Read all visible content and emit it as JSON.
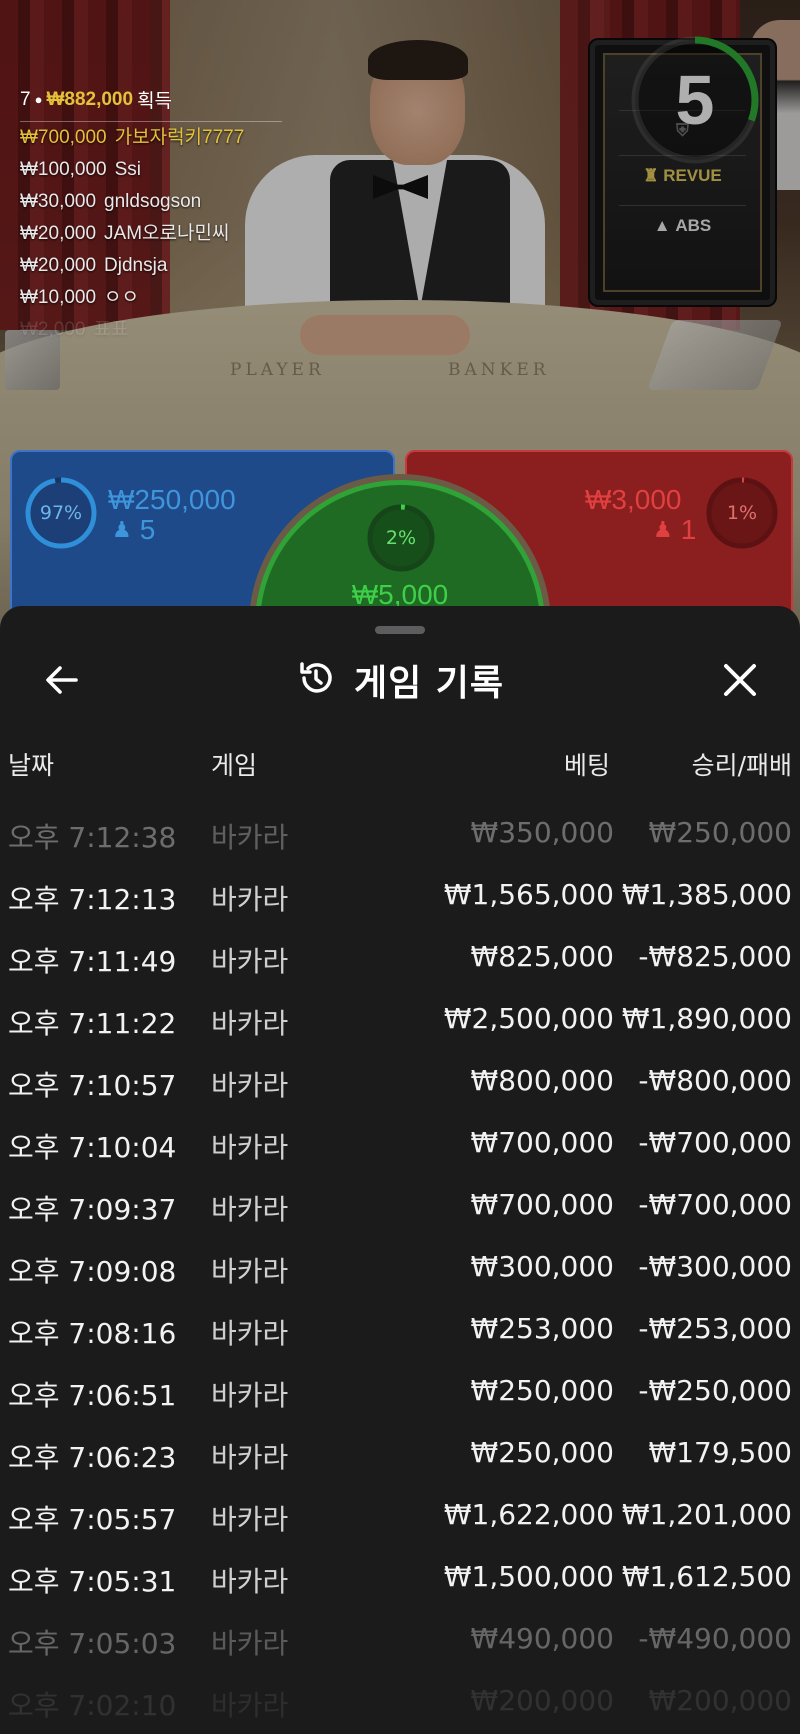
{
  "live": {
    "countdown": "5",
    "felt_labels": {
      "player": "PLAYER",
      "banker": "BANKER"
    },
    "screen_brands": [
      "REVUE",
      "ABS"
    ]
  },
  "winners": {
    "count": "7",
    "total": "₩882,000",
    "suffix": "획득",
    "rows": [
      {
        "amount": "₩700,000",
        "name": "가보자럭키7777"
      },
      {
        "amount": "₩100,000",
        "name": "Ssi"
      },
      {
        "amount": "₩30,000",
        "name": "gnldsogson"
      },
      {
        "amount": "₩20,000",
        "name": "JAM오로나민씨"
      },
      {
        "amount": "₩20,000",
        "name": "Djdnsja"
      },
      {
        "amount": "₩10,000",
        "name": "ㅇㅇ"
      },
      {
        "amount": "₩2,000",
        "name": "표표"
      }
    ]
  },
  "bets": {
    "player": {
      "percent": "97%",
      "percent_value": 97,
      "amount": "₩250,000",
      "players": "5",
      "color": "#1f4a8a"
    },
    "banker": {
      "percent": "1%",
      "percent_value": 1,
      "amount": "₩3,000",
      "players": "1",
      "color": "#8b1e1e"
    },
    "tie": {
      "percent": "2%",
      "percent_value": 2,
      "amount": "₩5,000",
      "color": "#1f6b23"
    }
  },
  "history": {
    "title": "게임 기록",
    "columns": {
      "date": "날짜",
      "game": "게임",
      "bet": "베팅",
      "result": "승리/패배"
    },
    "rows": [
      {
        "time": "오후 7:12:38",
        "game": "바카라",
        "bet": "₩350,000",
        "result": "₩250,000"
      },
      {
        "time": "오후 7:12:13",
        "game": "바카라",
        "bet": "₩1,565,000",
        "result": "₩1,385,000"
      },
      {
        "time": "오후 7:11:49",
        "game": "바카라",
        "bet": "₩825,000",
        "result": "-₩825,000"
      },
      {
        "time": "오후 7:11:22",
        "game": "바카라",
        "bet": "₩2,500,000",
        "result": "₩1,890,000"
      },
      {
        "time": "오후 7:10:57",
        "game": "바카라",
        "bet": "₩800,000",
        "result": "-₩800,000"
      },
      {
        "time": "오후 7:10:04",
        "game": "바카라",
        "bet": "₩700,000",
        "result": "-₩700,000"
      },
      {
        "time": "오후 7:09:37",
        "game": "바카라",
        "bet": "₩700,000",
        "result": "-₩700,000"
      },
      {
        "time": "오후 7:09:08",
        "game": "바카라",
        "bet": "₩300,000",
        "result": "-₩300,000"
      },
      {
        "time": "오후 7:08:16",
        "game": "바카라",
        "bet": "₩253,000",
        "result": "-₩253,000"
      },
      {
        "time": "오후 7:06:51",
        "game": "바카라",
        "bet": "₩250,000",
        "result": "-₩250,000"
      },
      {
        "time": "오후 7:06:23",
        "game": "바카라",
        "bet": "₩250,000",
        "result": "₩179,500"
      },
      {
        "time": "오후 7:05:57",
        "game": "바카라",
        "bet": "₩1,622,000",
        "result": "₩1,201,000"
      },
      {
        "time": "오후 7:05:31",
        "game": "바카라",
        "bet": "₩1,500,000",
        "result": "₩1,612,500"
      },
      {
        "time": "오후 7:05:03",
        "game": "바카라",
        "bet": "₩490,000",
        "result": "-₩490,000"
      },
      {
        "time": "오후 7:02:10",
        "game": "바카라",
        "bet": "₩200,000",
        "result": "₩200,000"
      }
    ]
  }
}
